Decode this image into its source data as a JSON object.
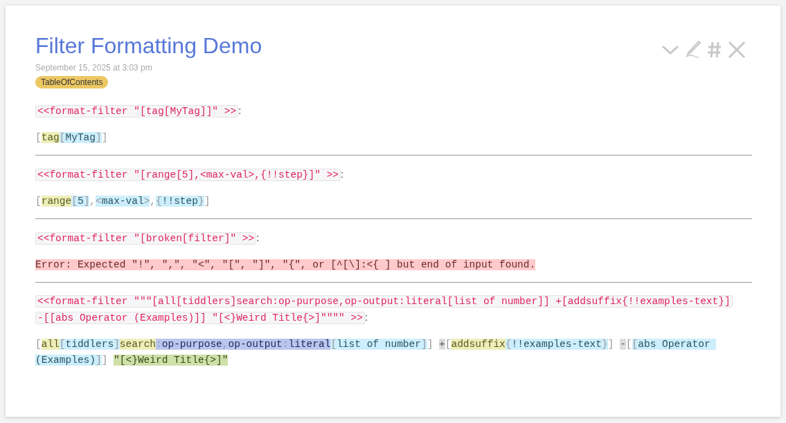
{
  "tiddler": {
    "title": "Filter Formatting Demo",
    "date": "September 15, 2025 at 3:03 pm",
    "tags": [
      "TableOfContents"
    ],
    "sections": [
      {
        "macro": [
          "<<format-filter \"[tag[MyTag]]\" >>"
        ],
        "after": ":",
        "output": {
          "kind": "tokens",
          "tokens": [
            {
              "kind": "punct",
              "text": "["
            },
            {
              "kind": "op",
              "text": "tag"
            },
            {
              "kind": "pbracket",
              "text": "["
            },
            {
              "kind": "param",
              "text": "MyTag"
            },
            {
              "kind": "pbracket",
              "text": "]"
            },
            {
              "kind": "punct",
              "text": "]"
            }
          ]
        }
      },
      {
        "macro": [
          "<<format-filter \"[range[5],<max-val>,{!!step}]\" >>"
        ],
        "after": ":",
        "output": {
          "kind": "tokens",
          "tokens": [
            {
              "kind": "punct",
              "text": "["
            },
            {
              "kind": "op",
              "text": "range"
            },
            {
              "kind": "pbracket",
              "text": "["
            },
            {
              "kind": "param",
              "text": "5"
            },
            {
              "kind": "pbracket",
              "text": "]"
            },
            {
              "kind": "punct",
              "text": ","
            },
            {
              "kind": "pbracket",
              "text": "<"
            },
            {
              "kind": "param",
              "text": "max-val"
            },
            {
              "kind": "pbracket",
              "text": ">"
            },
            {
              "kind": "punct",
              "text": ","
            },
            {
              "kind": "pbracket",
              "text": "{"
            },
            {
              "kind": "param",
              "text": "!!step"
            },
            {
              "kind": "pbracket",
              "text": "}"
            },
            {
              "kind": "punct",
              "text": "]"
            }
          ]
        }
      },
      {
        "macro": [
          "<<format-filter \"[broken[filter]\" >>"
        ],
        "after": ":",
        "output": {
          "kind": "error",
          "text": "Error: Expected \"!\", \",\", \"<\", \"[\", \"]\", \"{\", or [^[\\]:<{ ] but end of input found."
        }
      },
      {
        "macro": [
          "<<format-filter \"\"\"[all[tiddlers]search:op-purpose,op-output:literal[list of number]] +[addsuffix{!!examples-text}]",
          "-[[abs Operator (Examples)]] \"[<}Weird Title{>]\"\"\"\" >>"
        ],
        "after": ":",
        "output": {
          "kind": "tokens",
          "tokens": [
            {
              "kind": "punct",
              "text": "["
            },
            {
              "kind": "op",
              "text": "all"
            },
            {
              "kind": "pbracket",
              "text": "["
            },
            {
              "kind": "param",
              "text": "tiddlers"
            },
            {
              "kind": "pbracket",
              "text": "]"
            },
            {
              "kind": "op",
              "text": "search"
            },
            {
              "kind": "suffixsep",
              "text": ":"
            },
            {
              "kind": "suffix",
              "text": "op-purpose"
            },
            {
              "kind": "suffixsep",
              "text": ","
            },
            {
              "kind": "suffix",
              "text": "op-output"
            },
            {
              "kind": "suffixsep",
              "text": ":"
            },
            {
              "kind": "suffix",
              "text": "literal"
            },
            {
              "kind": "pbracket",
              "text": "["
            },
            {
              "kind": "param",
              "text": "list of number"
            },
            {
              "kind": "pbracket",
              "text": "]"
            },
            {
              "kind": "punct",
              "text": "]"
            },
            {
              "kind": "prefix",
              "text": "+",
              "gap_before": true
            },
            {
              "kind": "punct",
              "text": "["
            },
            {
              "kind": "op",
              "text": "addsuffix"
            },
            {
              "kind": "pbracket",
              "text": "{"
            },
            {
              "kind": "param",
              "text": "!!examples-text"
            },
            {
              "kind": "pbracket",
              "text": "}"
            },
            {
              "kind": "punct",
              "text": "]"
            },
            {
              "kind": "prefix",
              "text": "-",
              "gap_before": true
            },
            {
              "kind": "punct",
              "text": "["
            },
            {
              "kind": "pbracket",
              "text": "["
            },
            {
              "kind": "param",
              "text": "abs Operator (Examples)"
            },
            {
              "kind": "pbracket",
              "text": "]"
            },
            {
              "kind": "punct",
              "text": "]"
            },
            {
              "kind": "string",
              "text": "\"[<}Weird Title{>]\"",
              "gap_before": true
            }
          ]
        }
      }
    ]
  }
}
